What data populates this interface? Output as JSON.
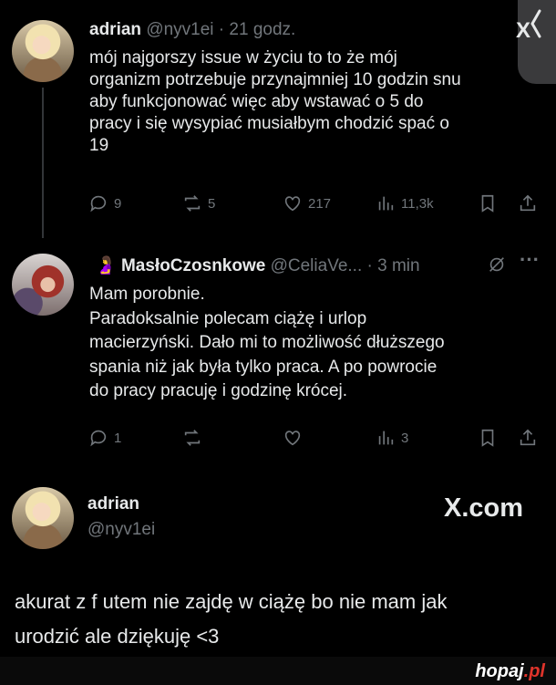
{
  "tweet1": {
    "author": "adrian",
    "handle_time": "@nyv1ei · 21 godz.",
    "text_lines": [
      "mój najgorszy issue w życiu to to że mój",
      "organizm potrzebuje przynajmniej 10 godzin snu",
      "aby funkcjonować więc aby wstawać o 5 do",
      "pracy i się wysypiać musiałbym chodzić spać o",
      "19"
    ],
    "replies": "9",
    "reposts": "5",
    "likes": "217",
    "views": "11,3k"
  },
  "tweet2": {
    "emoji": "🤰",
    "author": "MasłoCzosnkowe",
    "handle_time": "@CeliaVe... · 3 min",
    "text_lines": [
      "Mam porobnie.",
      "Paradoksalnie polecam ciążę i urlop",
      "macierzyński. Dało mi to możliwość dłuższego",
      "spania niż jak była tylko praca. A po powrocie",
      "do pracy pracuję i godzinę krócej."
    ],
    "replies": "1",
    "views": "3"
  },
  "tweet3": {
    "author": "adrian",
    "handle": "@nyv1ei",
    "brand": "X.com",
    "text_lines": [
      "akurat z f utem nie zajdę w ciążę bo nie mam jak",
      "urodzić ale dziękuję <3"
    ]
  },
  "watermark": {
    "main": "hopaj",
    "suffix": ".pl"
  },
  "colors": {
    "background": "#000000",
    "text": "#e7e9ea",
    "muted": "#71767b"
  }
}
